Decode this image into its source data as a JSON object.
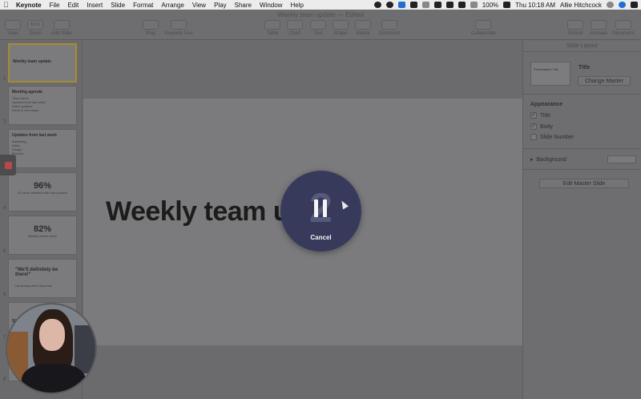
{
  "menubar": {
    "app_name": "Keynote",
    "menus": [
      "File",
      "Edit",
      "Insert",
      "Slide",
      "Format",
      "Arrange",
      "View",
      "Play",
      "Share",
      "Window",
      "Help"
    ],
    "battery": "100%",
    "clock": "Thu 10:18 AM",
    "user": "Allie Hitchcock"
  },
  "toolbar": {
    "document_title": "Weekly team update — Edited",
    "buttons": {
      "view": "View",
      "zoom_value": "51%",
      "zoom": "Zoom",
      "add_slide": "Add Slide",
      "play": "Play",
      "keynote_live": "Keynote Live",
      "table": "Table",
      "chart": "Chart",
      "text": "Text",
      "shape": "Shape",
      "media": "Media",
      "comment": "Comment",
      "collaborate": "Collaborate",
      "format": "Format",
      "animate": "Animate",
      "document": "Document"
    }
  },
  "navigator": {
    "slides": [
      {
        "number": "1",
        "title": "Weekly team update"
      },
      {
        "number": "2",
        "title": "Meeting agenda",
        "lines": [
          "Team intros",
          "Updates from last week",
          "Sales updates",
          "Ideas & next steps"
        ]
      },
      {
        "number": "3",
        "title": "Updates from last week",
        "lines": [
          "Marketing",
          "Sales",
          "Design",
          "Product"
        ]
      },
      {
        "number": "4",
        "big": "96%",
        "sub": "Of users satisfied with new product"
      },
      {
        "number": "5",
        "big": "82%",
        "sub": "Weekly active users"
      },
      {
        "number": "6",
        "quote": "\"We'll definitely be there!\"",
        "sub": "Upcoming client response"
      },
      {
        "number": "7",
        "title": "Sl"
      },
      {
        "number": "8"
      }
    ]
  },
  "canvas": {
    "slide_title": "Weekly team u"
  },
  "inspector": {
    "header": "Slide Layout",
    "master_thumb_text": "Presentation Title",
    "layout_title": "Title",
    "change_master": "Change Master",
    "appearance_label": "Appearance",
    "checks": [
      {
        "label": "Title",
        "checked": true
      },
      {
        "label": "Body",
        "checked": true
      },
      {
        "label": "Slide Number",
        "checked": false
      }
    ],
    "background_label": "Background",
    "edit_master": "Edit Master Slide"
  },
  "recording_overlay": {
    "countdown": "2",
    "cancel_label": "Cancel"
  },
  "colors": {
    "overlay_circle": "#383a5c",
    "record_red": "#b44a4a",
    "selected_thumb_border": "#a68c2e"
  }
}
